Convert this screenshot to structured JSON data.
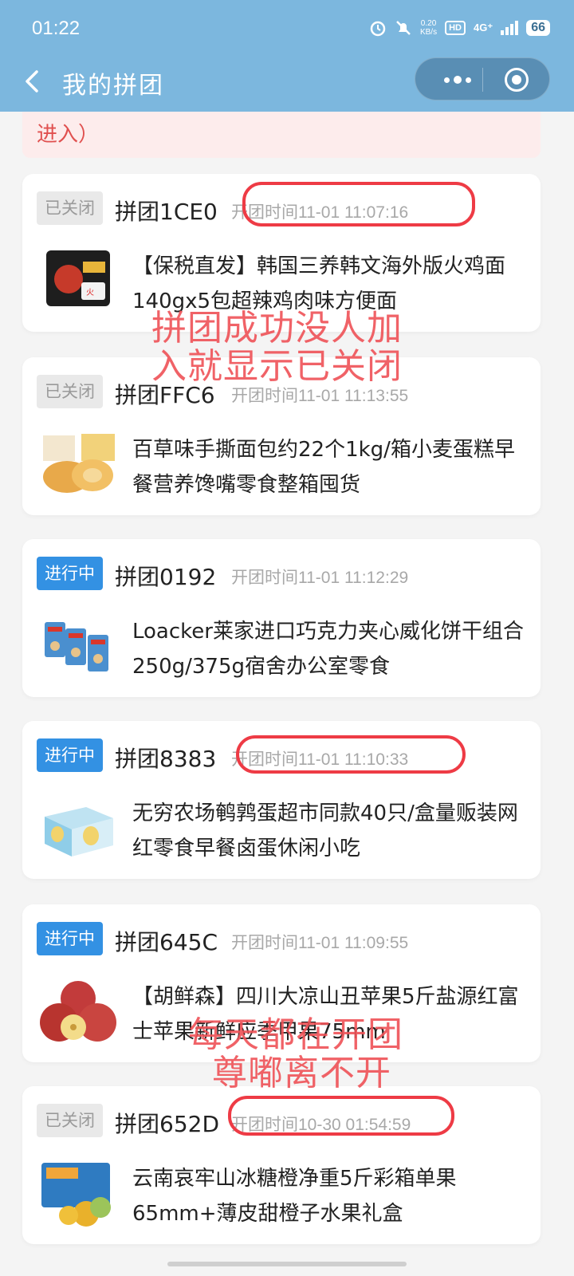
{
  "status_bar": {
    "time": "01:22",
    "speed_value": "0.20",
    "speed_unit": "KB/s",
    "hd": "HD",
    "network": "4G⁺",
    "battery": "66"
  },
  "nav": {
    "title": "我的拼团"
  },
  "notice": {
    "text": "进入）"
  },
  "colors": {
    "accent": "#7cb7de",
    "badge_active": "#3391e3",
    "badge_closed": "#e9e9e9",
    "annotation": "#ee3b45"
  },
  "groups": [
    {
      "status": "已关闭",
      "state": "closed",
      "group": "拼团1CE0",
      "open_time": "开团时间11-01 11:07:16",
      "title": "【保税直发】韩国三养韩文海外版火鸡面140gx5包超辣鸡肉味方便面",
      "image": "noodle-pack"
    },
    {
      "status": "已关闭",
      "state": "closed",
      "group": "拼团FFC6",
      "open_time": "开团时间11-01 11:13:55",
      "title": "百草味手撕面包约22个1kg/箱小麦蛋糕早餐营养馋嘴零食整箱囤货",
      "image": "bread"
    },
    {
      "status": "进行中",
      "state": "active",
      "group": "拼团0192",
      "open_time": "开团时间11-01 11:12:29",
      "title": "Loacker莱家进口巧克力夹心威化饼干组合250g/375g宿舍办公室零食",
      "image": "wafer-bags"
    },
    {
      "status": "进行中",
      "state": "active",
      "group": "拼团8383",
      "open_time": "开团时间11-01 11:10:33",
      "title": "无穷农场鹌鹑蛋超市同款40只/盒量贩装网红零食早餐卤蛋休闲小吃",
      "image": "egg-box"
    },
    {
      "status": "进行中",
      "state": "active",
      "group": "拼团645C",
      "open_time": "开团时间11-01 11:09:55",
      "title": "【胡鲜森】四川大凉山丑苹果5斤盐源红富士苹果新鲜应季甲果75mm",
      "image": "apples"
    },
    {
      "status": "已关闭",
      "state": "closed",
      "group": "拼团652D",
      "open_time": "开团时间10-30 01:54:59",
      "title": "云南哀牢山冰糖橙净重5斤彩箱单果65mm+薄皮甜橙子水果礼盒",
      "image": "orange-box"
    }
  ],
  "annotations": {
    "note1": [
      "拼团成功没人加",
      "入就显示已关闭"
    ],
    "note2": [
      "每天都在开团",
      "尊嘟离不开"
    ]
  }
}
